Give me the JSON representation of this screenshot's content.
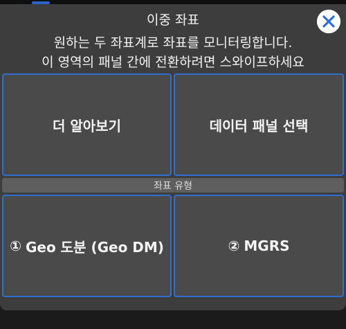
{
  "dialog": {
    "title": "이중 좌표",
    "subtitle_line1": "원하는 두 좌표계로 좌표를 모니터링합니다.",
    "subtitle_line2": "이 영역의 패널 간에 전환하려면 스와이프하세요"
  },
  "buttons": {
    "learn_more": "더 알아보기",
    "select_panel": "데이터 패널 선택"
  },
  "section": {
    "label": "좌표 유형"
  },
  "coordinate_types": [
    {
      "number": "①",
      "label": "Geo 도분 (Geo DM)"
    },
    {
      "number": "②",
      "label": "MGRS"
    }
  ],
  "icons": {
    "close": "close-icon"
  },
  "colors": {
    "accent": "#2f6fd0",
    "dialog_bg": "#3d3d3d",
    "panel_bg": "#4a4a4a"
  }
}
